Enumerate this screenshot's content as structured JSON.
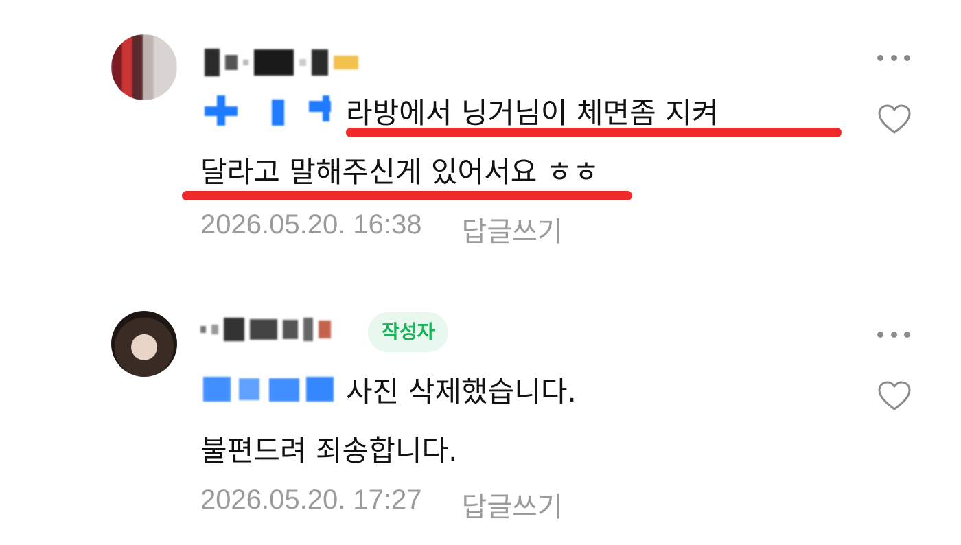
{
  "comments": [
    {
      "text_line1": "라방에서 닝거님이 체면좀 지켜",
      "text_line2": "달라고 말해주신게 있어서요 ㅎㅎ",
      "timestamp": "2026.05.20. 16:38",
      "reply_label": "답글쓰기",
      "more_icon": "more-horizontal-icon",
      "like_icon": "heart-outline-icon"
    },
    {
      "author_badge": "작성자",
      "text_line1": "사진 삭제했습니다.",
      "text_line2": "불편드려 죄송합니다.",
      "timestamp": "2026.05.20. 17:27",
      "reply_label": "답글쓰기",
      "more_icon": "more-horizontal-icon",
      "like_icon": "heart-outline-icon"
    }
  ],
  "colors": {
    "mention": "#1f7bff",
    "underline_annotation": "#ee2a2a",
    "author_badge_bg": "#e8f8ee",
    "author_badge_text": "#19b35a",
    "meta_text": "#9b9b9b"
  }
}
